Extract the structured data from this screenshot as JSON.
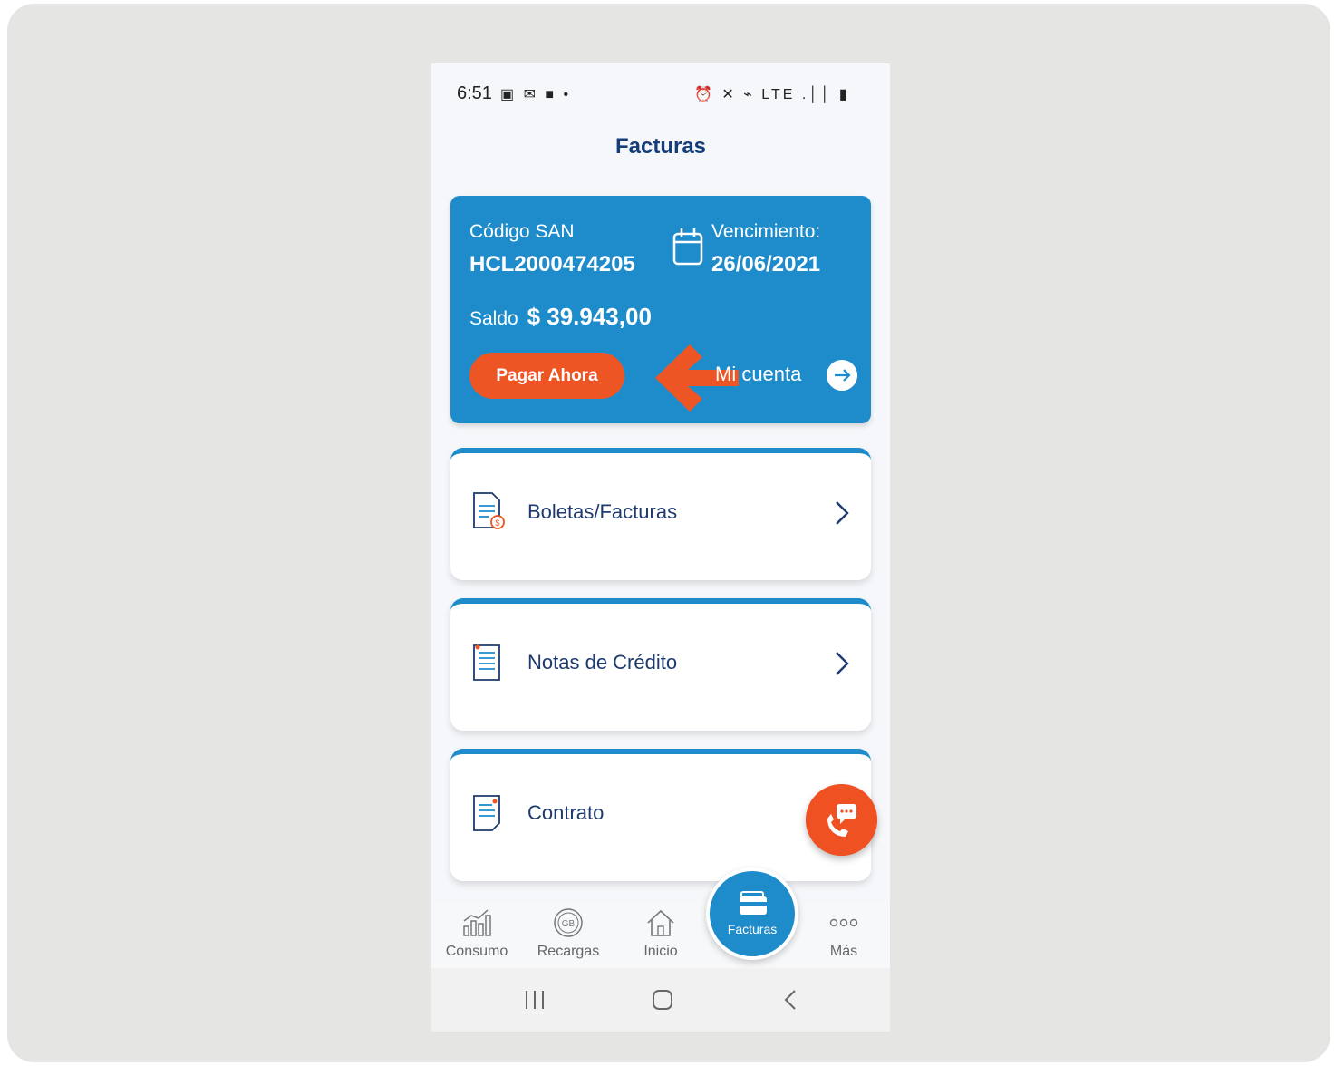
{
  "status_bar": {
    "time": "6:51",
    "left_icons": "▣ ✉ ■ •",
    "right_icons": "⏰ ✕ ⌁ LTE .││ ▮"
  },
  "page": {
    "title": "Facturas"
  },
  "account_card": {
    "san_label": "Código SAN",
    "san_code": "HCL2000474205",
    "due_label": "Vencimiento:",
    "due_date": "26/06/2021",
    "balance_label": "Saldo",
    "balance_amount": "$ 39.943,00",
    "pay_button": "Pagar Ahora",
    "account_link": "Mi cuenta"
  },
  "menu": [
    {
      "label": "Boletas/Facturas",
      "icon": "invoice-icon"
    },
    {
      "label": "Notas de Crédito",
      "icon": "credit-note-icon"
    },
    {
      "label": "Contrato",
      "icon": "contract-icon"
    }
  ],
  "bottom_nav": [
    {
      "label": "Consumo",
      "icon": "chart-icon"
    },
    {
      "label": "Recargas",
      "icon": "gb-icon"
    },
    {
      "label": "Inicio",
      "icon": "home-icon"
    },
    {
      "label": "Facturas",
      "icon": "wallet-icon",
      "active": true
    },
    {
      "label": "Más",
      "icon": "more-icon"
    }
  ],
  "colors": {
    "brand_blue": "#1e8ccb",
    "title_navy": "#143d7a",
    "accent_orange": "#ee5524",
    "background_gray": "#e5e5e3"
  }
}
